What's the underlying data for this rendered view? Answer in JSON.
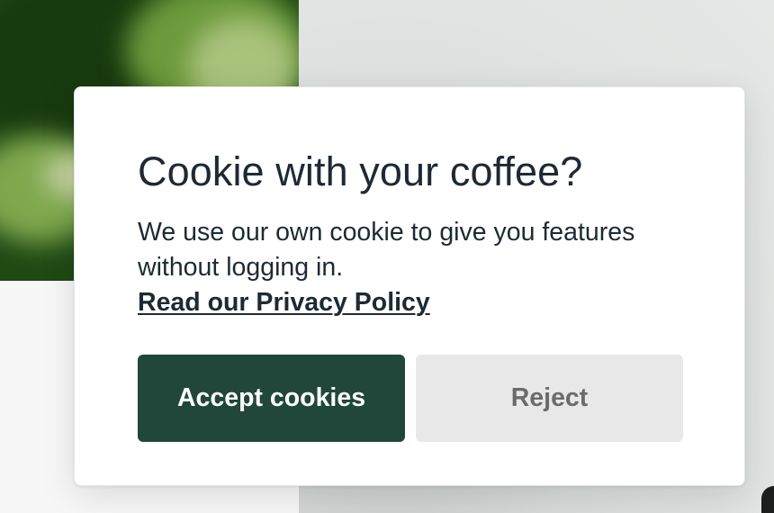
{
  "cookie_dialog": {
    "title": "Cookie with your coffee?",
    "body": "We use our own cookie to give you features without logging in.",
    "privacy_link": "Read our Privacy Policy",
    "accept_label": "Accept cookies",
    "reject_label": "Reject"
  },
  "colors": {
    "accept_button": "#21473a",
    "reject_button": "#e8e8e8",
    "text": "#1d2a33"
  }
}
